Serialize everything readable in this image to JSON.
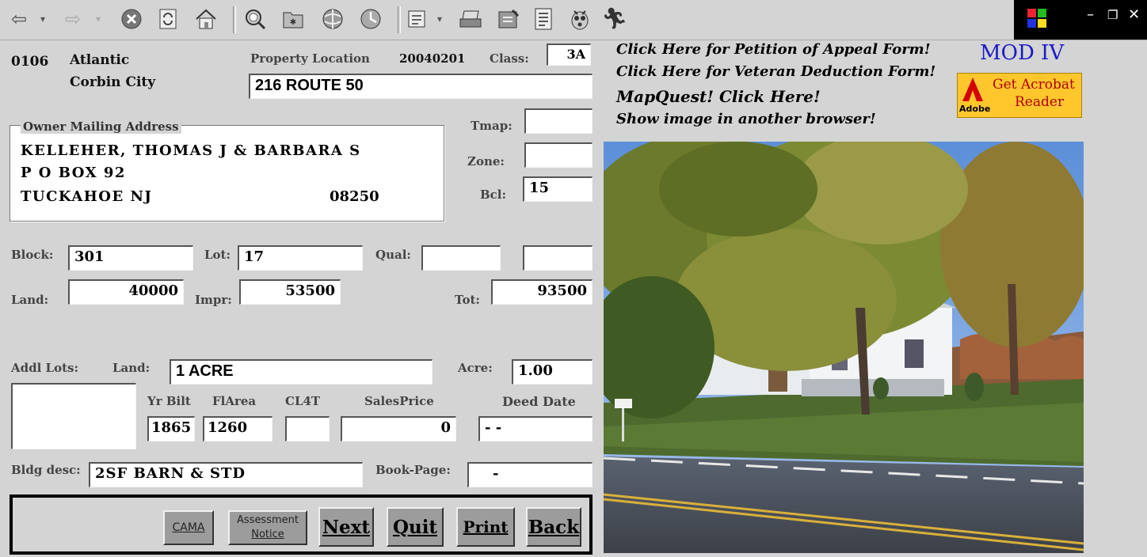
{
  "toolbar": {
    "buttons": [
      "back-icon",
      "forward-icon",
      "stop-icon",
      "refresh-icon",
      "home-icon",
      "search-icon",
      "favorites-icon",
      "history-icon",
      "channels-icon",
      "mail-icon",
      "print-icon",
      "edit-icon",
      "discuss-icon",
      "bug-icon",
      "messenger-icon"
    ]
  },
  "header": {
    "county_code": "0106",
    "county": "Atlantic",
    "municipality": "Corbin City",
    "property_location_label": "Property Location",
    "date_code": "20040201",
    "class_label": "Class:",
    "class_value": "3A",
    "address": "216 ROUTE 50"
  },
  "owner": {
    "legend": "Owner Mailing Address",
    "name": "KELLEHER, THOMAS J & BARBARA S",
    "line2": "P O BOX 92",
    "city_state": "TUCKAHOE  NJ",
    "zip": "08250"
  },
  "side_fields": {
    "tmap_label": "Tmap:",
    "tmap": "",
    "zone_label": "Zone:",
    "zone": "",
    "bcl_label": "Bcl:",
    "bcl": "15"
  },
  "parcel": {
    "block_label": "Block:",
    "block": "301",
    "lot_label": "Lot:",
    "lot": "17",
    "qual_label": "Qual:",
    "qual": "",
    "qual2": "",
    "land_label": "Land:",
    "land": "40000",
    "impr_label": "Impr:",
    "impr": "53500",
    "tot_label": "Tot:",
    "tot": "93500"
  },
  "details": {
    "addl_lots_label": "Addl Lots:",
    "land_label": "Land:",
    "land_desc": "1 ACRE",
    "acre_label": "Acre:",
    "acre": "1.00",
    "yr_bilt_label": "Yr Bilt",
    "yr_bilt": "1865",
    "flarea_label": "FlArea",
    "flarea": "1260",
    "cl4t_label": "CL4T",
    "cl4t": "",
    "sales_price_label": "SalesPrice",
    "sales_price": "0",
    "deed_date_label": "Deed Date",
    "deed_date": "- -",
    "bldg_desc_label": "Bldg desc:",
    "bldg_desc": "2SF BARN & STD",
    "book_page_label": "Book-Page:",
    "book_page": "-"
  },
  "buttons": {
    "cama": "CAMA",
    "assessment_line1": "Assessment",
    "assessment_line2": "Notice",
    "next": "Next",
    "quit": "Quit",
    "print": "Print",
    "back": "Back"
  },
  "links": {
    "appeal": "Click Here for Petition of Appeal Form!",
    "veteran": "Click Here for Veteran Deduction Form!",
    "mapquest": "MapQuest! Click Here!",
    "show_image": "Show image in another browser!"
  },
  "branding": {
    "mod_iv": "MOD IV",
    "acrobat_line1": "Get Acrobat",
    "acrobat_line2": "Reader",
    "adobe": "Adobe"
  }
}
